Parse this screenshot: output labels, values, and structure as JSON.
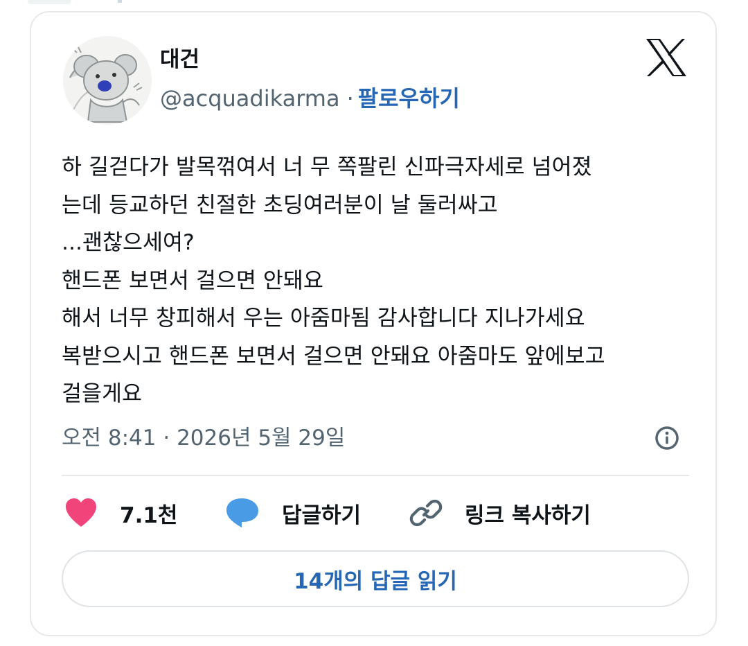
{
  "author": {
    "name": "대건",
    "handle": "@acquadikarma",
    "separator": "·",
    "follow_label": "팔로우하기"
  },
  "icons": {
    "avatar": "avatar-koala-drawing",
    "platform": "x-logo-icon",
    "info": "info-icon",
    "like": "heart-icon",
    "reply": "speech-bubble-icon",
    "copy": "link-icon"
  },
  "tweet": {
    "lines": [
      "하 길걷다가 발목꺾여서 너 무 쪽팔린 신파극자세로 넘어졌",
      "는데 등교하던 친절한 초딩여러분이 날 둘러싸고",
      "...괜찮으세여?",
      "핸드폰 보면서 걸으면 안돼요",
      "해서 너무 창피해서 우는 아줌마됨 감사합니다 지나가세요",
      "복받으시고 핸드폰 보면서 걸으면 안돼요 아줌마도 앞에보고",
      "걸을게요"
    ],
    "timestamp": "오전 8:41 · 2026년 5월 29일"
  },
  "actions": {
    "like_count": "7.1천",
    "reply_label": "답글하기",
    "copy_link_label": "링크 복사하기"
  },
  "read_replies_label": "14개의 답글 읽기",
  "colors": {
    "accent": "#2566b5",
    "heart": "#f0447a",
    "reply_bubble": "#4a9be6",
    "secondary_text": "#536471",
    "border": "#e6e8ea"
  }
}
